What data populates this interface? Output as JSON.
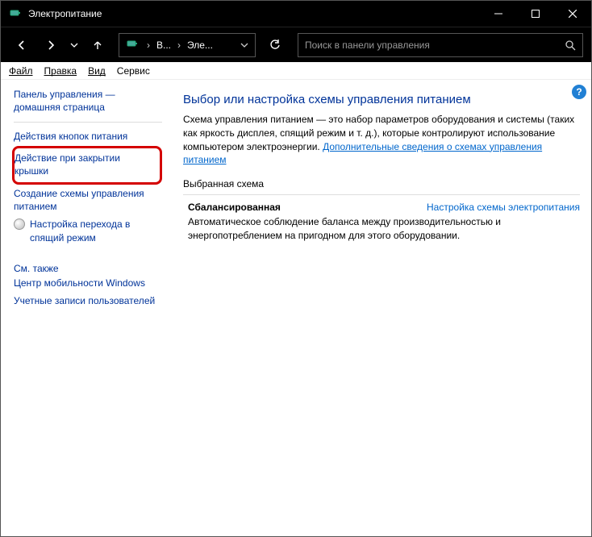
{
  "titlebar": {
    "title": "Электропитание"
  },
  "breadcrumb": {
    "seg1": "В...",
    "seg2": "Эле..."
  },
  "search": {
    "placeholder": "Поиск в панели управления"
  },
  "menu": {
    "file": "Файл",
    "edit": "Правка",
    "view": "Вид",
    "service": "Сервис"
  },
  "sidebar": {
    "home": "Панель управления — домашняя страница",
    "link_buttons": "Действия кнопок питания",
    "link_lid": "Действие при закрытии крышки",
    "link_create": "Создание схемы управления питанием",
    "link_sleep": "Настройка перехода в спящий режим",
    "see_also_hdr": "См. также",
    "see_also_1": "Центр мобильности Windows",
    "see_also_2": "Учетные записи пользователей"
  },
  "main": {
    "heading": "Выбор или настройка схемы управления питанием",
    "desc_1": "Схема управления питанием — это набор параметров оборудования и системы (таких как яркость дисплея, спящий режим и т. д.), которые контролируют использование компьютером электроэнергии. ",
    "desc_link": "Дополнительные сведения о схемах управления питанием",
    "section": "Выбранная схема",
    "scheme_name": "Сбалансированная",
    "scheme_link": "Настройка схемы электропитания",
    "scheme_desc": "Автоматическое соблюдение баланса между производительностью и энергопотреблением на пригодном для этого оборудовании."
  }
}
